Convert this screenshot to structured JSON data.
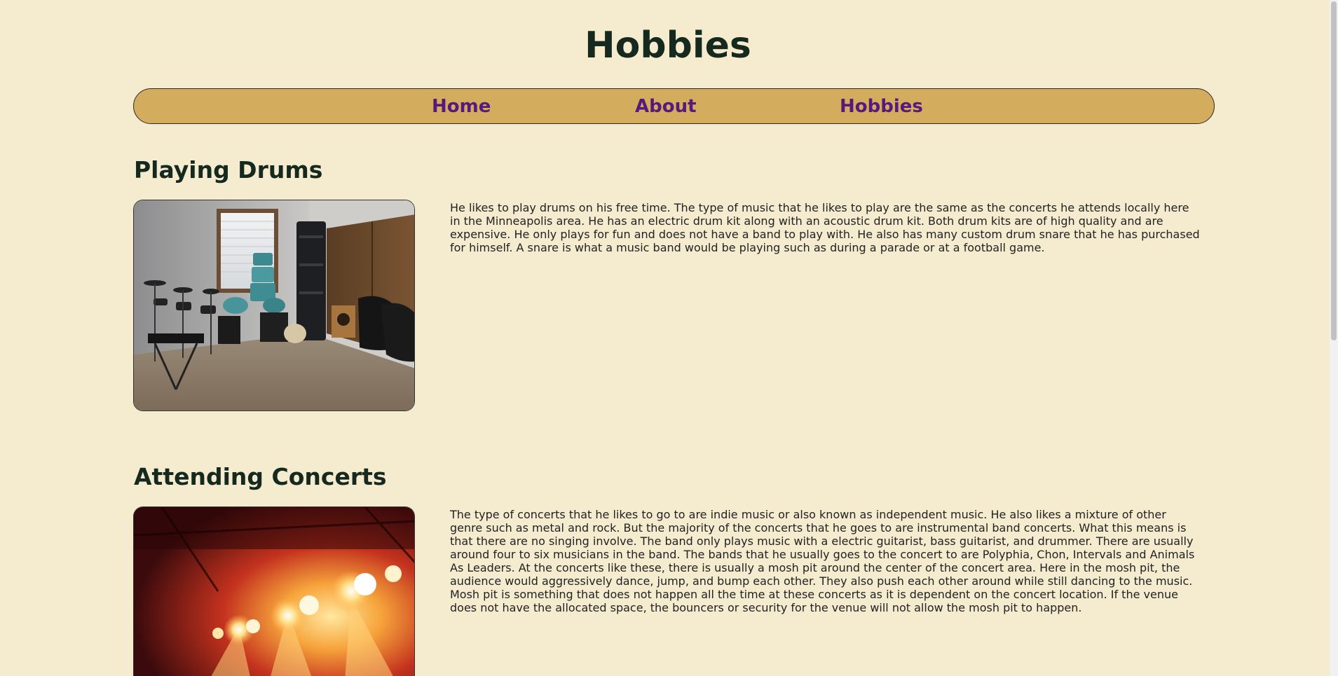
{
  "page": {
    "title": "Hobbies"
  },
  "nav": {
    "home": "Home",
    "about": "About",
    "hobbies": "Hobbies"
  },
  "sections": [
    {
      "heading": "Playing Drums",
      "image_alt": "Room with electric and acoustic drum kits",
      "text": "He likes to play drums on his free time. The type of music that he likes to play are the same as the concerts he attends locally here in the Minneapolis area. He has an electric drum kit along with an acoustic drum kit. Both drum kits are of high quality and are expensive. He only plays for fun and does not have a band to play with. He also has many custom drum snare that he has purchased for himself. A snare is what a music band would be playing such as during a parade or at a football game."
    },
    {
      "heading": "Attending Concerts",
      "image_alt": "Concert stage lights",
      "text": "The type of concerts that he likes to go to are indie music or also known as independent music. He also likes a mixture of other genre such as metal and rock. But the majority of the concerts that he goes to are instrumental band concerts. What this means is that there are no singing involve. The band only plays music with a electric guitarist, bass guitarist, and drummer. There are usually around four to six musicians in the band. The bands that he usually goes to the concert to are Polyphia, Chon, Intervals and Animals As Leaders. At the concerts like these, there is usually a mosh pit around the center of the concert area. Here in the mosh pit, the audience would aggressively dance, jump, and bump each other. They also push each other around while still dancing to the music. Mosh pit is something that does not happen all the time at these concerts as it is dependent on the concert location. If the venue does not have the allocated space, the bouncers or security for the venue will not allow the mosh pit to happen."
    }
  ]
}
